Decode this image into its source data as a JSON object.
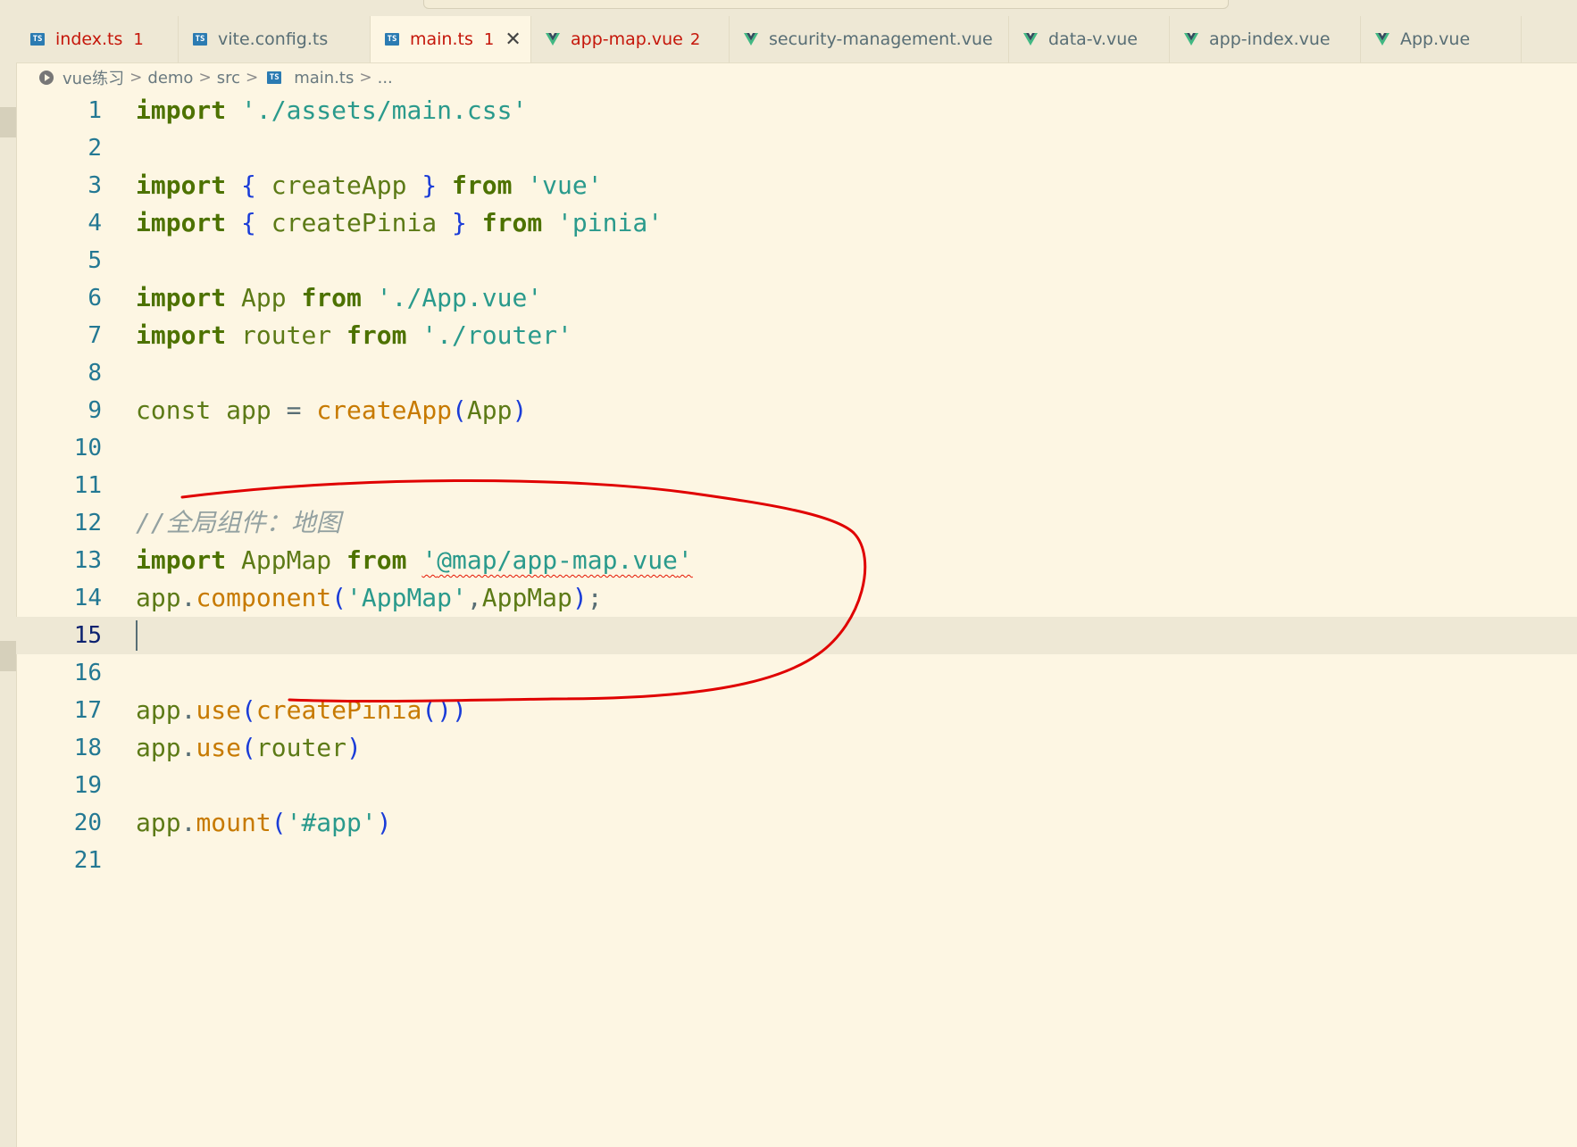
{
  "tabs": [
    {
      "label": "index.ts",
      "icon": "ts-icon",
      "badge": "1",
      "error": true
    },
    {
      "label": "vite.config.ts",
      "icon": "ts-icon",
      "badge": "",
      "error": false
    },
    {
      "label": "main.ts",
      "icon": "ts-icon",
      "badge": "1",
      "error": true,
      "active": true
    },
    {
      "label": "app-map.vue",
      "icon": "vue-icon",
      "badge": "2",
      "error": true
    },
    {
      "label": "security-management.vue",
      "icon": "vue-icon",
      "badge": "",
      "error": false
    },
    {
      "label": "data-v.vue",
      "icon": "vue-icon",
      "badge": "",
      "error": false
    },
    {
      "label": "app-index.vue",
      "icon": "vue-icon",
      "badge": "",
      "error": false
    },
    {
      "label": "App.vue",
      "icon": "vue-icon",
      "badge": "",
      "error": false
    }
  ],
  "breadcrumb": [
    "vue练习",
    "demo",
    "src",
    "main.ts",
    "..."
  ],
  "colors": {
    "vue_green": "#41b883",
    "ts_blue": "#2b7bb2",
    "error_red": "#c5160a",
    "annotation": "#e00000"
  },
  "editor": {
    "current_line": 15,
    "lines": [
      {
        "n": "1"
      },
      {
        "n": "2"
      },
      {
        "n": "3"
      },
      {
        "n": "4"
      },
      {
        "n": "5"
      },
      {
        "n": "6"
      },
      {
        "n": "7"
      },
      {
        "n": "8"
      },
      {
        "n": "9"
      },
      {
        "n": "10"
      },
      {
        "n": "11"
      },
      {
        "n": "12"
      },
      {
        "n": "13"
      },
      {
        "n": "14"
      },
      {
        "n": "15"
      },
      {
        "n": "16"
      },
      {
        "n": "17"
      },
      {
        "n": "18"
      },
      {
        "n": "19"
      },
      {
        "n": "20"
      },
      {
        "n": "21"
      }
    ],
    "tokens": {
      "l1": [
        "import",
        "'./assets/main.css'"
      ],
      "l3": [
        "import",
        "{",
        "createApp",
        "}",
        "from",
        "'vue'"
      ],
      "l4": [
        "import",
        "{",
        "createPinia",
        "}",
        "from",
        "'pinia'"
      ],
      "l6": [
        "import",
        "App",
        "from",
        "'./App.vue'"
      ],
      "l7": [
        "import",
        "router",
        "from",
        "'./router'"
      ],
      "l9": [
        "const",
        "app",
        "=",
        "createApp",
        "(",
        "App",
        ")"
      ],
      "l12": [
        "//全局组件：地图"
      ],
      "l13": [
        "import",
        "AppMap",
        "from",
        "'",
        "@map/app-map.vue",
        "'"
      ],
      "l14": [
        "app",
        ".",
        "component",
        "(",
        "'AppMap'",
        ",",
        "AppMap",
        ")",
        ";"
      ],
      "l17": [
        "app",
        ".",
        "use",
        "(",
        "createPinia",
        "()",
        ")"
      ],
      "l18": [
        "app",
        ".",
        "use",
        "(",
        "router",
        ")"
      ],
      "l20": [
        "app",
        ".",
        "mount",
        "(",
        "'#app'",
        ")"
      ]
    }
  }
}
